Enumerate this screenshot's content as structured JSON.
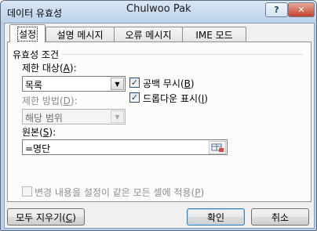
{
  "window": {
    "title": "데이터 유효성",
    "user": "Chulwoo Pak",
    "help_label": "?",
    "close_label": "✕"
  },
  "tabs": [
    {
      "label": "설정",
      "active": true
    },
    {
      "label": "설명 메시지",
      "active": false
    },
    {
      "label": "오류 메시지",
      "active": false
    },
    {
      "label": "IME 모드",
      "active": false
    }
  ],
  "validation": {
    "section_title": "유효성 조건",
    "allow_label": "제한 대상",
    "allow_hotkey": "A",
    "allow_value": "목록",
    "data_label": "제한 방법",
    "data_hotkey": "D",
    "data_value": "해당 범위",
    "ignore_blank_label": "공백 무시",
    "ignore_blank_hotkey": "B",
    "ignore_blank_checked": true,
    "in_cell_dropdown_label": "드롭다운 표시",
    "in_cell_dropdown_hotkey": "I",
    "in_cell_dropdown_checked": true,
    "source_label": "원본",
    "source_hotkey": "S",
    "source_value": "=명단"
  },
  "apply_all": {
    "label": "변경 내용을 설정이 같은 모든 셀에 적용",
    "hotkey": "P",
    "checked": false
  },
  "footer": {
    "clear_all_label": "모두 지우기",
    "clear_all_hotkey": "C",
    "ok_label": "확인",
    "cancel_label": "취소"
  },
  "dropdown_glyph": "▼",
  "check_glyph": "✓",
  "icons": {
    "range_reference": "range-select-icon"
  }
}
